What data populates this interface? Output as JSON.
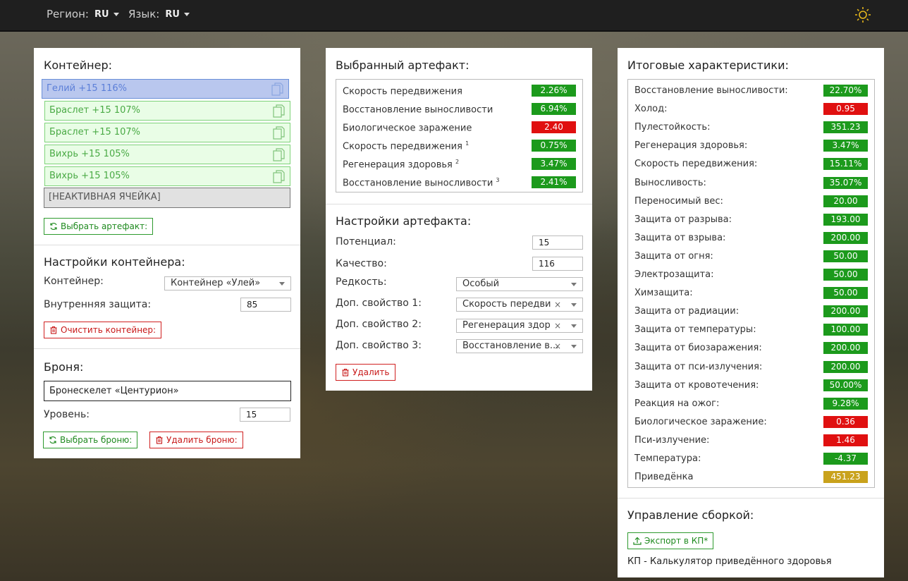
{
  "topbar": {
    "region_label": "Регион:",
    "region_value": "RU",
    "lang_label": "Язык:",
    "lang_value": "RU",
    "theme_icon": "sun-icon"
  },
  "container_panel": {
    "title": "Контейнер:",
    "slots": [
      "Гелий +15 116%",
      "Браслет +15 107%",
      "Браслет +15 107%",
      "Вихрь +15 105%",
      "Вихрь +15 105%",
      "[НЕАКТИВНАЯ ЯЧЕЙКА]"
    ],
    "select_artifact_btn": "Выбрать артефакт:",
    "settings_title": "Настройки контейнера:",
    "container_label": "Контейнер:",
    "container_value": "Контейнер «Улей»",
    "inner_protection_label": "Внутренняя защита:",
    "inner_protection_value": "85",
    "clear_btn": "Очистить контейнер:",
    "armor_title": "Броня:",
    "armor_value": "Бронескелет «Центурион»",
    "level_label": "Уровень:",
    "level_value": "15",
    "select_armor_btn": "Выбрать броню:",
    "delete_armor_btn": "Удалить броню:"
  },
  "artifact_panel": {
    "title": "Выбранный артефакт:",
    "stats": [
      {
        "name": "Скорость передвижения",
        "sup": "",
        "value": "2.26%",
        "color": "pos"
      },
      {
        "name": "Восстановление выносливости",
        "sup": "",
        "value": "6.94%",
        "color": "pos"
      },
      {
        "name": "Биологическое заражение",
        "sup": "",
        "value": "2.40",
        "color": "neg"
      },
      {
        "name": "Скорость передвижения",
        "sup": "1",
        "value": "0.75%",
        "color": "pos"
      },
      {
        "name": "Регенерация здоровья",
        "sup": "2",
        "value": "3.47%",
        "color": "pos"
      },
      {
        "name": "Восстановление выносливости",
        "sup": "3",
        "value": "2.41%",
        "color": "pos"
      }
    ],
    "settings_title": "Настройки артефакта:",
    "potential_label": "Потенциал:",
    "potential_value": "15",
    "quality_label": "Качество:",
    "quality_value": "116",
    "rarity_label": "Редкость:",
    "rarity_value": "Особый",
    "extra1_label": "Доп. свойство 1:",
    "extra1_value": "Скорость передви",
    "extra2_label": "Доп. свойство 2:",
    "extra2_value": "Регенерация здор",
    "extra3_label": "Доп. свойство 3:",
    "extra3_value": "Восстановление в...",
    "delete_btn": "Удалить"
  },
  "totals_panel": {
    "title": "Итоговые характеристики:",
    "stats": [
      {
        "name": "Восстановление выносливости:",
        "value": "22.70%",
        "color": "pos"
      },
      {
        "name": "Холод:",
        "value": "0.95",
        "color": "neg"
      },
      {
        "name": "Пулестойкость:",
        "value": "351.23",
        "color": "pos"
      },
      {
        "name": "Регенерация здоровья:",
        "value": "3.47%",
        "color": "pos"
      },
      {
        "name": "Скорость передвижения:",
        "value": "15.11%",
        "color": "pos"
      },
      {
        "name": "Выносливость:",
        "value": "35.07%",
        "color": "pos"
      },
      {
        "name": "Переносимый вес:",
        "value": "20.00",
        "color": "pos"
      },
      {
        "name": "Защита от разрыва:",
        "value": "193.00",
        "color": "pos"
      },
      {
        "name": "Защита от взрыва:",
        "value": "200.00",
        "color": "pos"
      },
      {
        "name": "Защита от огня:",
        "value": "50.00",
        "color": "pos"
      },
      {
        "name": "Электрозащита:",
        "value": "50.00",
        "color": "pos"
      },
      {
        "name": "Химзащита:",
        "value": "50.00",
        "color": "pos"
      },
      {
        "name": "Защита от радиации:",
        "value": "200.00",
        "color": "pos"
      },
      {
        "name": "Защита от температуры:",
        "value": "100.00",
        "color": "pos"
      },
      {
        "name": "Защита от биозаражения:",
        "value": "200.00",
        "color": "pos"
      },
      {
        "name": "Защита от пси-излучения:",
        "value": "200.00",
        "color": "pos"
      },
      {
        "name": "Защита от кровотечения:",
        "value": "50.00%",
        "color": "pos"
      },
      {
        "name": "Реакция на ожог:",
        "value": "9.28%",
        "color": "pos"
      },
      {
        "name": "Биологическое заражение:",
        "value": "0.36",
        "color": "neg"
      },
      {
        "name": "Пси-излучение:",
        "value": "1.46",
        "color": "neg"
      },
      {
        "name": "Температура:",
        "value": "-4.37",
        "color": "pos"
      },
      {
        "name": "Приведёнка",
        "value": "451.23",
        "color": "gold"
      }
    ],
    "build_title": "Управление сборкой:",
    "export_btn": "Экспорт в КП*",
    "footnote": "КП - Калькулятор приведённого здоровья"
  }
}
